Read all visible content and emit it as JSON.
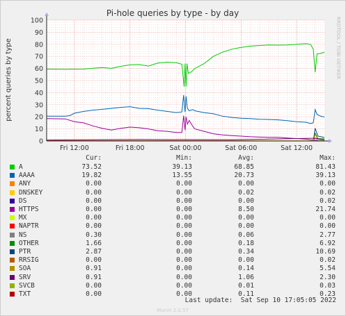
{
  "chart_data": {
    "type": "line",
    "title": "Pi-hole queries by type - by day",
    "ylabel": "percent queries by type",
    "ylim": [
      0,
      100
    ],
    "yticks": [
      0,
      10,
      20,
      30,
      40,
      50,
      60,
      70,
      80,
      90,
      100
    ],
    "x_range_hours": [
      0,
      30
    ],
    "x_ticks": [
      {
        "label": "Fri 12:00",
        "hour": 3
      },
      {
        "label": "Fri 18:00",
        "hour": 9
      },
      {
        "label": "Sat 00:00",
        "hour": 15
      },
      {
        "label": "Sat 06:00",
        "hour": 21
      },
      {
        "label": "Sat 12:00",
        "hour": 27
      }
    ],
    "grid": true,
    "side_label": "RRDTOOL / TOBI OETIKER",
    "footer": "Munin 2.0.57",
    "last_update": "Last update:  Sat Sep 10 17:05:05 2022",
    "columns": [
      "Cur:",
      "Min:",
      "Avg:",
      "Max:"
    ],
    "series": [
      {
        "name": "A",
        "color": "#00cc00",
        "cur": "73.52",
        "min": "39.13",
        "avg": "68.85",
        "max": "81.43",
        "points": [
          [
            0,
            59.5
          ],
          [
            2,
            59.3
          ],
          [
            4,
            59.5
          ],
          [
            5,
            60.2
          ],
          [
            6,
            60.8
          ],
          [
            7,
            60.1
          ],
          [
            8,
            61.8
          ],
          [
            9,
            63
          ],
          [
            10,
            63.2
          ],
          [
            11,
            62
          ],
          [
            12,
            64.5
          ],
          [
            13,
            65.2
          ],
          [
            14,
            64.8
          ],
          [
            14.6,
            63.5
          ],
          [
            14.85,
            45
          ],
          [
            14.95,
            64
          ],
          [
            15.05,
            45
          ],
          [
            15.15,
            64
          ],
          [
            15.3,
            56
          ],
          [
            15.6,
            57
          ],
          [
            16,
            60
          ],
          [
            17,
            64
          ],
          [
            18,
            70
          ],
          [
            19,
            73.5
          ],
          [
            20,
            76
          ],
          [
            21,
            77.5
          ],
          [
            22,
            78.5
          ],
          [
            23,
            79
          ],
          [
            24,
            79.5
          ],
          [
            25,
            79.3
          ],
          [
            26,
            79.5
          ],
          [
            27,
            80
          ],
          [
            28,
            80.5
          ],
          [
            28.5,
            80
          ],
          [
            28.8,
            76
          ],
          [
            29,
            57
          ],
          [
            29.2,
            72
          ],
          [
            29.6,
            72.5
          ],
          [
            30,
            73.5
          ]
        ]
      },
      {
        "name": "AAAA",
        "color": "#0066b3",
        "cur": "19.82",
        "min": "13.55",
        "avg": "20.73",
        "max": "39.13",
        "points": [
          [
            0,
            20.5
          ],
          [
            2,
            20.5
          ],
          [
            2.5,
            21
          ],
          [
            3,
            23
          ],
          [
            4,
            24.5
          ],
          [
            5,
            25.5
          ],
          [
            6,
            26.2
          ],
          [
            7,
            27
          ],
          [
            8,
            27.8
          ],
          [
            9,
            28.4
          ],
          [
            10,
            27
          ],
          [
            11,
            26.8
          ],
          [
            12,
            25.5
          ],
          [
            13,
            24.5
          ],
          [
            14,
            23.5
          ],
          [
            14.6,
            24
          ],
          [
            14.8,
            38
          ],
          [
            14.95,
            24
          ],
          [
            15.05,
            37
          ],
          [
            15.2,
            27
          ],
          [
            15.4,
            25
          ],
          [
            15.8,
            26
          ],
          [
            16,
            25
          ],
          [
            17,
            23.5
          ],
          [
            18,
            22.5
          ],
          [
            19,
            20.5
          ],
          [
            20,
            19.5
          ],
          [
            21,
            18.8
          ],
          [
            22,
            18.5
          ],
          [
            23,
            18
          ],
          [
            24,
            17.8
          ],
          [
            25,
            17.5
          ],
          [
            26,
            16.8
          ],
          [
            27,
            16
          ],
          [
            28,
            15.5
          ],
          [
            28.5,
            14.5
          ],
          [
            28.8,
            15
          ],
          [
            29,
            26
          ],
          [
            29.2,
            22
          ],
          [
            29.6,
            20.5
          ],
          [
            30,
            19.8
          ]
        ]
      },
      {
        "name": "ANY",
        "color": "#ff8000",
        "cur": "0.00",
        "min": "0.00",
        "avg": "0.00",
        "max": "0.00",
        "points": [
          [
            0,
            0
          ],
          [
            30,
            0
          ]
        ]
      },
      {
        "name": "DNSKEY",
        "color": "#ffcc00",
        "cur": "0.00",
        "min": "0.00",
        "avg": "0.02",
        "max": "0.02",
        "points": [
          [
            0,
            0.1
          ],
          [
            30,
            0.1
          ]
        ]
      },
      {
        "name": "DS",
        "color": "#330099",
        "cur": "0.00",
        "min": "0.00",
        "avg": "0.00",
        "max": "0.02",
        "points": [
          [
            0,
            0
          ],
          [
            30,
            0
          ]
        ]
      },
      {
        "name": "HTTPS",
        "color": "#990099",
        "cur": "0.00",
        "min": "0.00",
        "avg": "8.50",
        "max": "21.74",
        "points": [
          [
            0,
            18.5
          ],
          [
            2,
            18.3
          ],
          [
            3,
            16
          ],
          [
            4,
            15
          ],
          [
            5,
            12.5
          ],
          [
            6,
            10.5
          ],
          [
            7,
            9
          ],
          [
            8,
            10.5
          ],
          [
            9,
            11.5
          ],
          [
            10,
            11
          ],
          [
            11,
            10
          ],
          [
            12,
            8.5
          ],
          [
            13,
            8
          ],
          [
            14,
            7
          ],
          [
            14.6,
            7
          ],
          [
            14.8,
            21
          ],
          [
            14.95,
            9
          ],
          [
            15.05,
            20
          ],
          [
            15.2,
            14
          ],
          [
            15.4,
            17
          ],
          [
            15.8,
            12
          ],
          [
            16,
            10
          ],
          [
            17,
            8
          ],
          [
            18,
            6
          ],
          [
            19,
            5
          ],
          [
            20,
            4.5
          ],
          [
            21,
            4
          ],
          [
            22,
            3.5
          ],
          [
            23,
            3.2
          ],
          [
            24,
            3
          ],
          [
            25,
            3
          ],
          [
            26,
            2.5
          ],
          [
            27,
            2
          ],
          [
            28,
            1.5
          ],
          [
            28.5,
            1
          ],
          [
            28.8,
            0.8
          ],
          [
            29,
            0.6
          ],
          [
            29.5,
            0.2
          ],
          [
            30,
            0
          ]
        ]
      },
      {
        "name": "MX",
        "color": "#ccff00",
        "cur": "0.00",
        "min": "0.00",
        "avg": "0.00",
        "max": "0.00",
        "points": [
          [
            0,
            0
          ],
          [
            30,
            0
          ]
        ]
      },
      {
        "name": "NAPTR",
        "color": "#ff0000",
        "cur": "0.00",
        "min": "0.00",
        "avg": "0.00",
        "max": "0.00",
        "points": [
          [
            0,
            0
          ],
          [
            30,
            0
          ]
        ]
      },
      {
        "name": "NS",
        "color": "#808080",
        "cur": "0.30",
        "min": "0.00",
        "avg": "0.06",
        "max": "2.77",
        "points": [
          [
            0,
            0
          ],
          [
            28.8,
            0
          ],
          [
            29,
            2.5
          ],
          [
            29.3,
            0.5
          ],
          [
            30,
            0.3
          ]
        ]
      },
      {
        "name": "OTHER",
        "color": "#008f00",
        "cur": "1.66",
        "min": "0.00",
        "avg": "0.18",
        "max": "6.92",
        "points": [
          [
            0,
            0
          ],
          [
            28.8,
            0
          ],
          [
            29,
            6.5
          ],
          [
            29.3,
            2
          ],
          [
            30,
            1.7
          ]
        ]
      },
      {
        "name": "PTR",
        "color": "#00487d",
        "cur": "2.87",
        "min": "0.00",
        "avg": "0.34",
        "max": "10.69",
        "points": [
          [
            0,
            0
          ],
          [
            28.8,
            0
          ],
          [
            29,
            10.5
          ],
          [
            29.3,
            4
          ],
          [
            30,
            2.9
          ]
        ]
      },
      {
        "name": "RRSIG",
        "color": "#b35a00",
        "cur": "0.00",
        "min": "0.00",
        "avg": "0.00",
        "max": "0.02",
        "points": [
          [
            0,
            0
          ],
          [
            30,
            0
          ]
        ]
      },
      {
        "name": "SOA",
        "color": "#b38f00",
        "cur": "0.91",
        "min": "0.00",
        "avg": "0.14",
        "max": "5.54",
        "points": [
          [
            0,
            0
          ],
          [
            28.8,
            0
          ],
          [
            29,
            5.5
          ],
          [
            29.3,
            1.5
          ],
          [
            30,
            0.9
          ]
        ]
      },
      {
        "name": "SRV",
        "color": "#6b006b",
        "cur": "0.91",
        "min": "0.00",
        "avg": "1.06",
        "max": "2.30",
        "points": [
          [
            0,
            0.8
          ],
          [
            10,
            1.2
          ],
          [
            20,
            1
          ],
          [
            29,
            2.3
          ],
          [
            30,
            0.9
          ]
        ]
      },
      {
        "name": "SVCB",
        "color": "#8fb300",
        "cur": "0.00",
        "min": "0.00",
        "avg": "0.01",
        "max": "0.03",
        "points": [
          [
            0,
            0.05
          ],
          [
            30,
            0.05
          ]
        ]
      },
      {
        "name": "TXT",
        "color": "#b30000",
        "cur": "0.00",
        "min": "0.00",
        "avg": "0.11",
        "max": "0.23",
        "points": [
          [
            0,
            0.2
          ],
          [
            15,
            0.1
          ],
          [
            30,
            0
          ]
        ]
      }
    ]
  }
}
